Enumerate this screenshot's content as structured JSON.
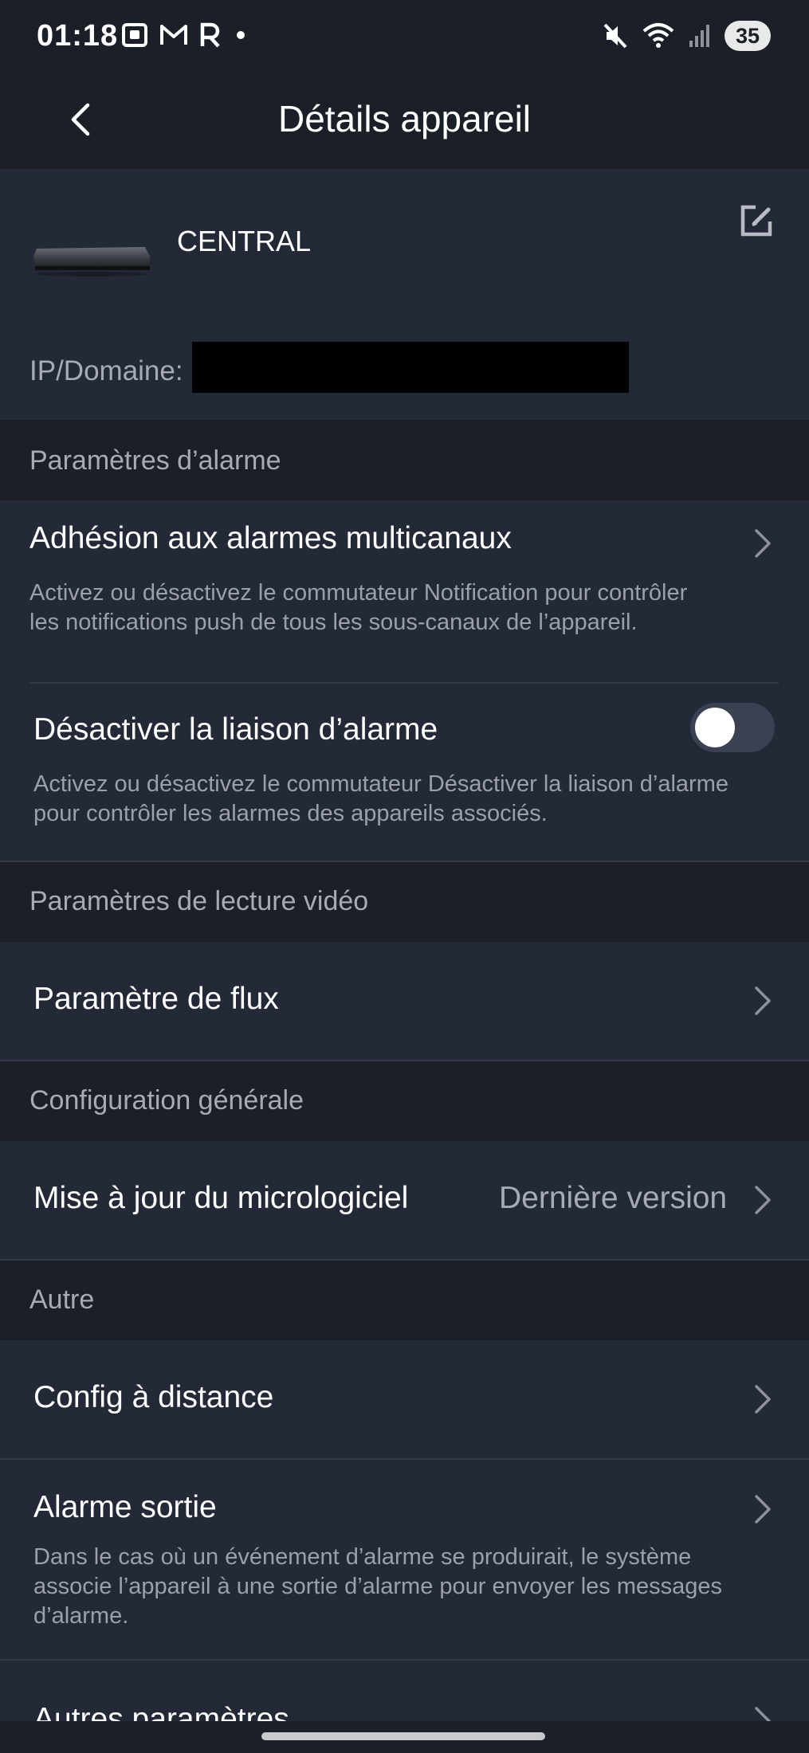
{
  "status_bar": {
    "time": "01:18",
    "left_icons": [
      "screenshot-icon",
      "gmail-icon",
      "r-app-icon",
      "dot-icon"
    ],
    "right_icons": [
      "mute-icon",
      "wifi-icon",
      "signal-icon"
    ],
    "battery": "35"
  },
  "header": {
    "title": "Détails appareil",
    "back_icon": "chevron-left-icon"
  },
  "device": {
    "name": "CENTRAL",
    "ip_label": "IP/Domaine:",
    "edit_icon": "edit-icon"
  },
  "sections": {
    "alarm": {
      "header": "Paramètres d’alarme",
      "multichannel_title": "Adhésion aux alarmes multicanaux",
      "multichannel_desc": "Activez ou désactivez le commutateur Notification pour contrôler les notifications push de tous les sous-canaux de l’appareil.",
      "linkage_title": "Désactiver la liaison d’alarme",
      "linkage_desc": "Activez ou désactivez le commutateur Désactiver la liaison d’alarme pour contrôler les alarmes des appareils associés.",
      "linkage_enabled": false
    },
    "video": {
      "header": "Paramètres de lecture vidéo",
      "stream_title": "Paramètre de flux"
    },
    "general": {
      "header": "Configuration générale",
      "firmware_title": "Mise à jour du micrologiciel",
      "firmware_value": "Dernière version"
    },
    "other": {
      "header": "Autre",
      "remote_config_title": "Config à distance",
      "alarm_output_title": "Alarme sortie",
      "alarm_output_desc": "Dans le cas où un événement d’alarme se produirait, le système associe l’appareil à une sortie d’alarme pour envoyer les messages d’alarme.",
      "other_params_title": "Autres paramètres"
    }
  },
  "colors": {
    "background": "#1b1f27",
    "card": "#232937",
    "secondary_text": "#a6abb6"
  }
}
